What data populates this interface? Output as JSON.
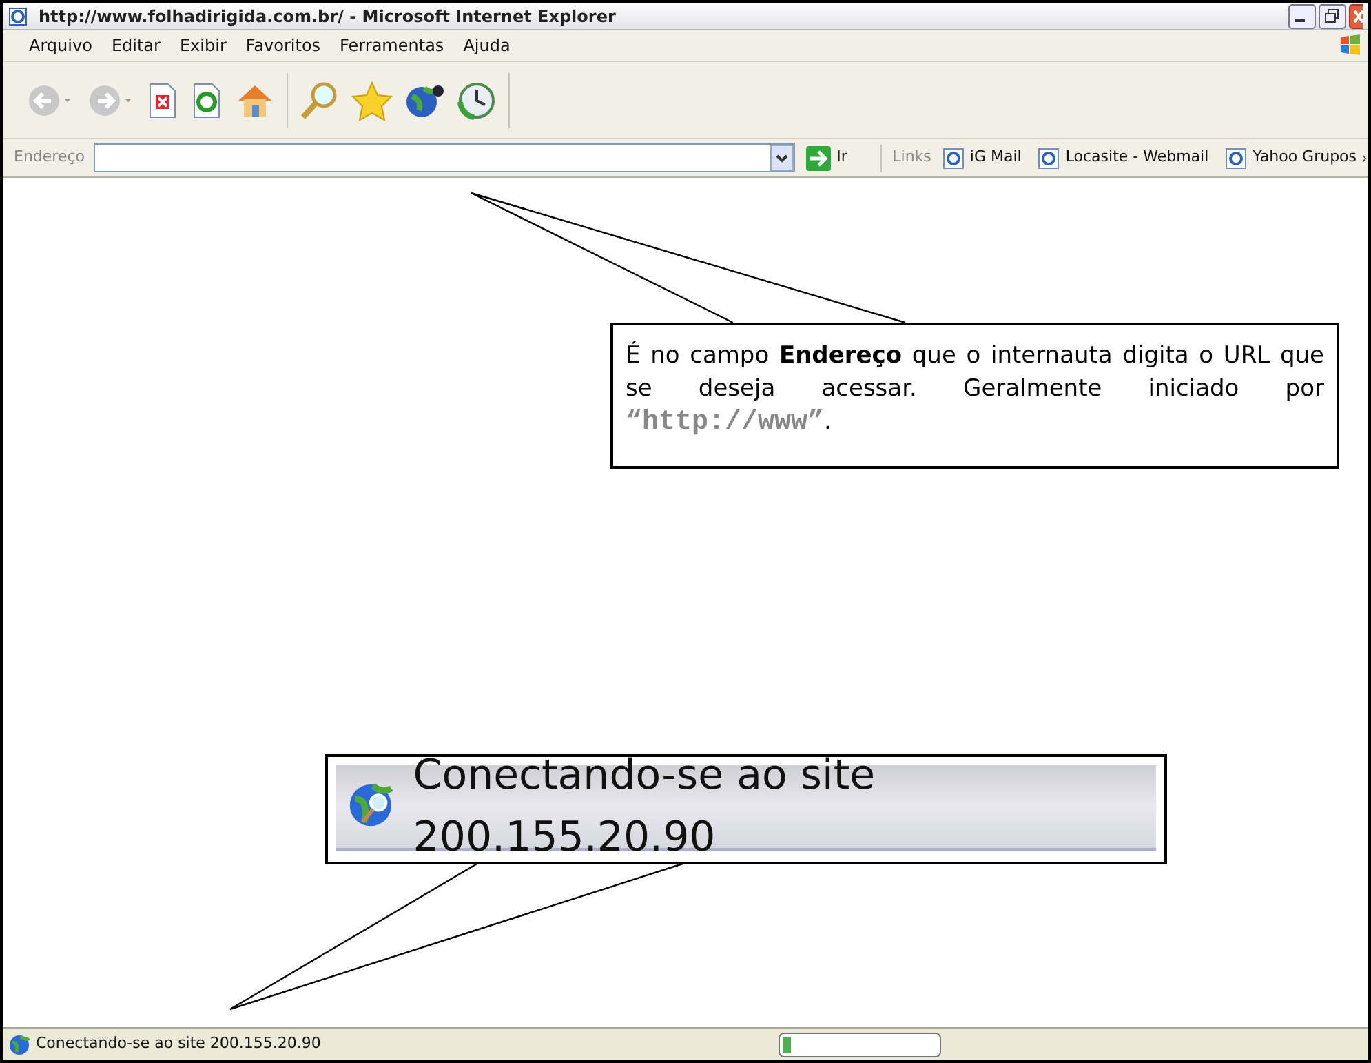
{
  "window": {
    "title": "http://www.folhadirigida.com.br/ - Microsoft Internet Explorer"
  },
  "menu": [
    "Arquivo",
    "Editar",
    "Exibir",
    "Favoritos",
    "Ferramentas",
    "Ajuda"
  ],
  "address_bar": {
    "label": "Endereço",
    "go_button": "Ir"
  },
  "links_bar": {
    "label": "Links",
    "links": [
      "iG Mail",
      "Locasite - Webmail",
      "Yahoo Grupos"
    ]
  },
  "status_bar": {
    "text": "Conectando-se ao site 200.155.20.90",
    "level": 0.05
  },
  "callouts": [
    {
      "kind": "note",
      "text": "É no campo **Endereço** que o internauta digita o URL que se deseja acessar. Geralmente iniciado por",
      "code": "“http://www”",
      "end": "."
    },
    {
      "kind": "zoom",
      "text": "Conectando-se ao site 200.155.20.90"
    }
  ]
}
